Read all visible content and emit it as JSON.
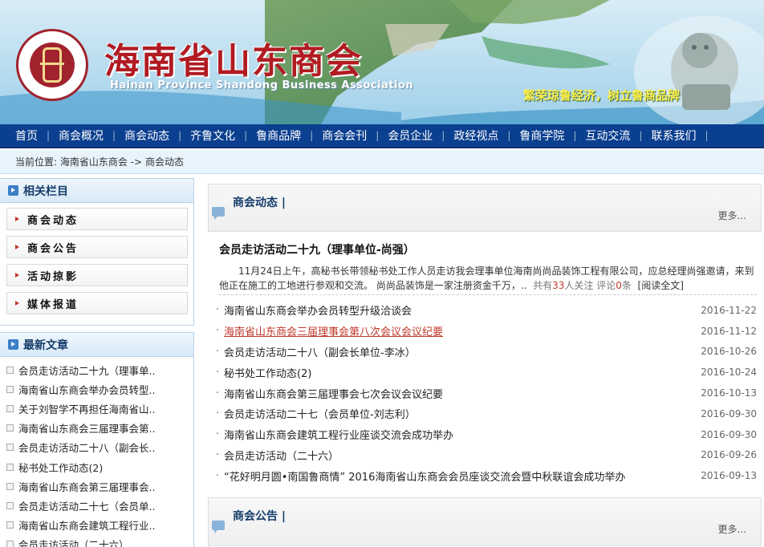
{
  "banner": {
    "title_cn": "海南省山东商会",
    "title_en": "Hainan Province Shandong Business Association",
    "slogan": "繁荣琼鲁经济，树立鲁商品牌"
  },
  "nav": {
    "items": [
      "首页",
      "商会概况",
      "商会动态",
      "齐鲁文化",
      "鲁商品牌",
      "商会会刊",
      "会员企业",
      "政经视点",
      "鲁商学院",
      "互动交流",
      "联系我们"
    ],
    "separator": "|"
  },
  "breadcrumb": {
    "prefix": "当前位置:",
    "home": "海南省山东商会",
    "arrow": "->",
    "current": "商会动态"
  },
  "sidebar": {
    "related_title": "相关栏目",
    "categories": [
      "商会动态",
      "商会公告",
      "活动掠影",
      "媒体报道"
    ],
    "latest_title": "最新文章",
    "latest": [
      "会员走访活动二十九（理事单..",
      "海南省山东商会举办会员转型..",
      "关于刘智学不再担任海南省山..",
      "海南省山东商会三届理事会第..",
      "会员走访活动二十八（副会长..",
      "秘书处工作动态(2)",
      "海南省山东商会第三届理事会..",
      "会员走访活动二十七（会员单..",
      "海南省山东商会建筑工程行业..",
      "会员走访活动（二十六）"
    ]
  },
  "news": {
    "title": "商会动态",
    "more": "更多...",
    "feature": {
      "title": "会员走访活动二十九（理事单位-尚强）",
      "summary": "11月24日上午，高秘书长带领秘书处工作人员走访我会理事单位海南尚尚品装饰工程有限公司，应总经理尚强邀请，来到他正在施工的工地进行参观和交流。 尚尚品装饰是一家注册资金千万，..",
      "meta_prefix": "共有",
      "views": "33",
      "meta_mid": "人关注 评论",
      "comments": "0",
      "meta_suffix": "条",
      "read_more": "[阅读全文]"
    },
    "items": [
      {
        "title": "海南省山东商会举办会员转型升级洽谈会",
        "date": "2016-11-22"
      },
      {
        "title": "海南省山东商会三届理事会第八次会议会议纪要",
        "date": "2016-11-12"
      },
      {
        "title": "会员走访活动二十八（副会长单位-李冰）",
        "date": "2016-10-26"
      },
      {
        "title": "秘书处工作动态(2)",
        "date": "2016-10-24"
      },
      {
        "title": "海南省山东商会第三届理事会七次会议会议纪要",
        "date": "2016-10-13"
      },
      {
        "title": "会员走访活动二十七（会员单位-刘志利）",
        "date": "2016-09-30"
      },
      {
        "title": "海南省山东商会建筑工程行业座谈交流会成功举办",
        "date": "2016-09-30"
      },
      {
        "title": "会员走访活动（二十六）",
        "date": "2016-09-26"
      },
      {
        "title": "“花好明月圆•南国鲁商情” 2016海南省山东商会会员座谈交流会暨中秋联谊会成功举办",
        "date": "2016-09-13"
      }
    ],
    "bullet": "·"
  },
  "notice": {
    "title": "商会公告",
    "more": "更多..."
  }
}
